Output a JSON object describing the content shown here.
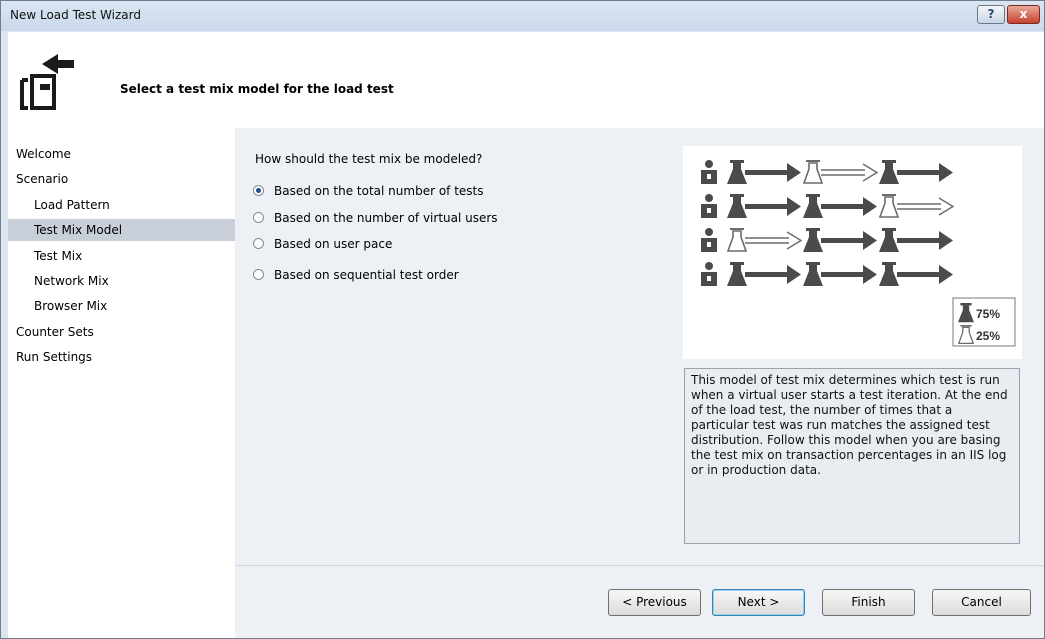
{
  "window": {
    "title": "New Load Test Wizard",
    "help_label": "?",
    "close_label": "x"
  },
  "header": {
    "title": "Select a test mix model for the load test",
    "icon": "wizard-step-icon"
  },
  "nav": {
    "items": [
      {
        "label": "Welcome"
      },
      {
        "label": "Scenario"
      },
      {
        "label": "Load Pattern"
      },
      {
        "label": "Test Mix Model"
      },
      {
        "label": "Test Mix"
      },
      {
        "label": "Network Mix"
      },
      {
        "label": "Browser Mix"
      },
      {
        "label": "Counter Sets"
      },
      {
        "label": "Run Settings"
      }
    ],
    "selected": "Test Mix Model"
  },
  "main": {
    "question": "How should the test mix be modeled?",
    "options": [
      {
        "label": "Based on the total number of tests",
        "checked": true
      },
      {
        "label": "Based on the number of virtual users",
        "checked": false
      },
      {
        "label": "Based on user pace",
        "checked": false
      },
      {
        "label": "Based on sequential test order",
        "checked": false
      }
    ],
    "diagram": {
      "legend_dark": "75%",
      "legend_light": "25%",
      "colors": {
        "dark": "#4b4b4b",
        "light_outline": "#6b6b6b"
      }
    },
    "description": "This model of test mix determines which test is run when a virtual user starts a test iteration. At the end of the load test, the number of times that a particular test was run matches the assigned test distribution. Follow this model when you are basing the test mix on transaction percentages in an IIS log or in production data."
  },
  "buttons": {
    "previous": "< Previous",
    "next": "Next >",
    "finish": "Finish",
    "cancel": "Cancel"
  }
}
